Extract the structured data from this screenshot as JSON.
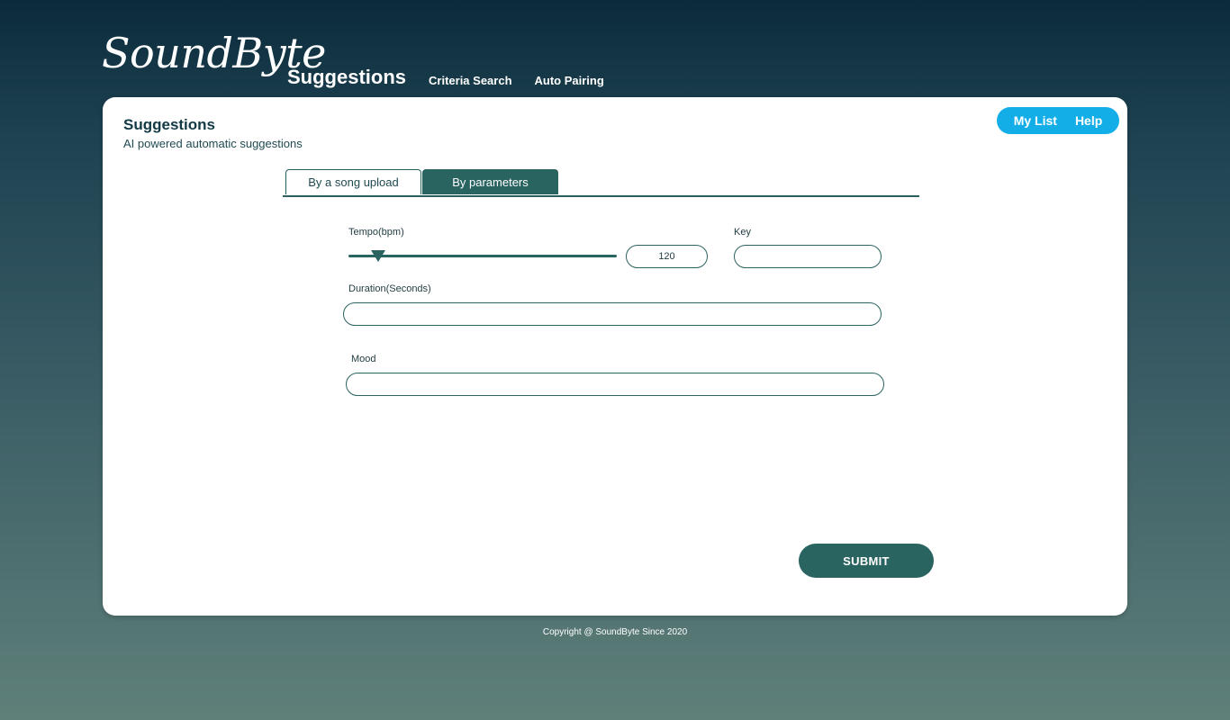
{
  "header": {
    "logo_text": "SoundByte",
    "nav": [
      {
        "label": "Suggestions",
        "active": true
      },
      {
        "label": "Criteria Search",
        "active": false
      },
      {
        "label": "Auto Pairing",
        "active": false
      }
    ]
  },
  "card": {
    "title": "Suggestions",
    "subtitle": "AI powered automatic suggestions",
    "quick_links": [
      "My List",
      "Help"
    ]
  },
  "tabs": [
    {
      "label": "By a song upload",
      "active": false
    },
    {
      "label": "By parameters",
      "active": true
    }
  ],
  "form": {
    "tempo_label": "Tempo(bpm)",
    "tempo_value": "120",
    "key_label": "Key",
    "key_value": "",
    "duration_label": "Duration(Seconds)",
    "duration_value": "",
    "mood_label": "Mood",
    "mood_value": "",
    "submit_label": "SUBMIT"
  },
  "footer": {
    "copyright": "Copyright @ SoundByte Since 2020"
  },
  "colors": {
    "primary": "#2a6461",
    "accent": "#13aee8",
    "card_bg": "#ffffff"
  }
}
